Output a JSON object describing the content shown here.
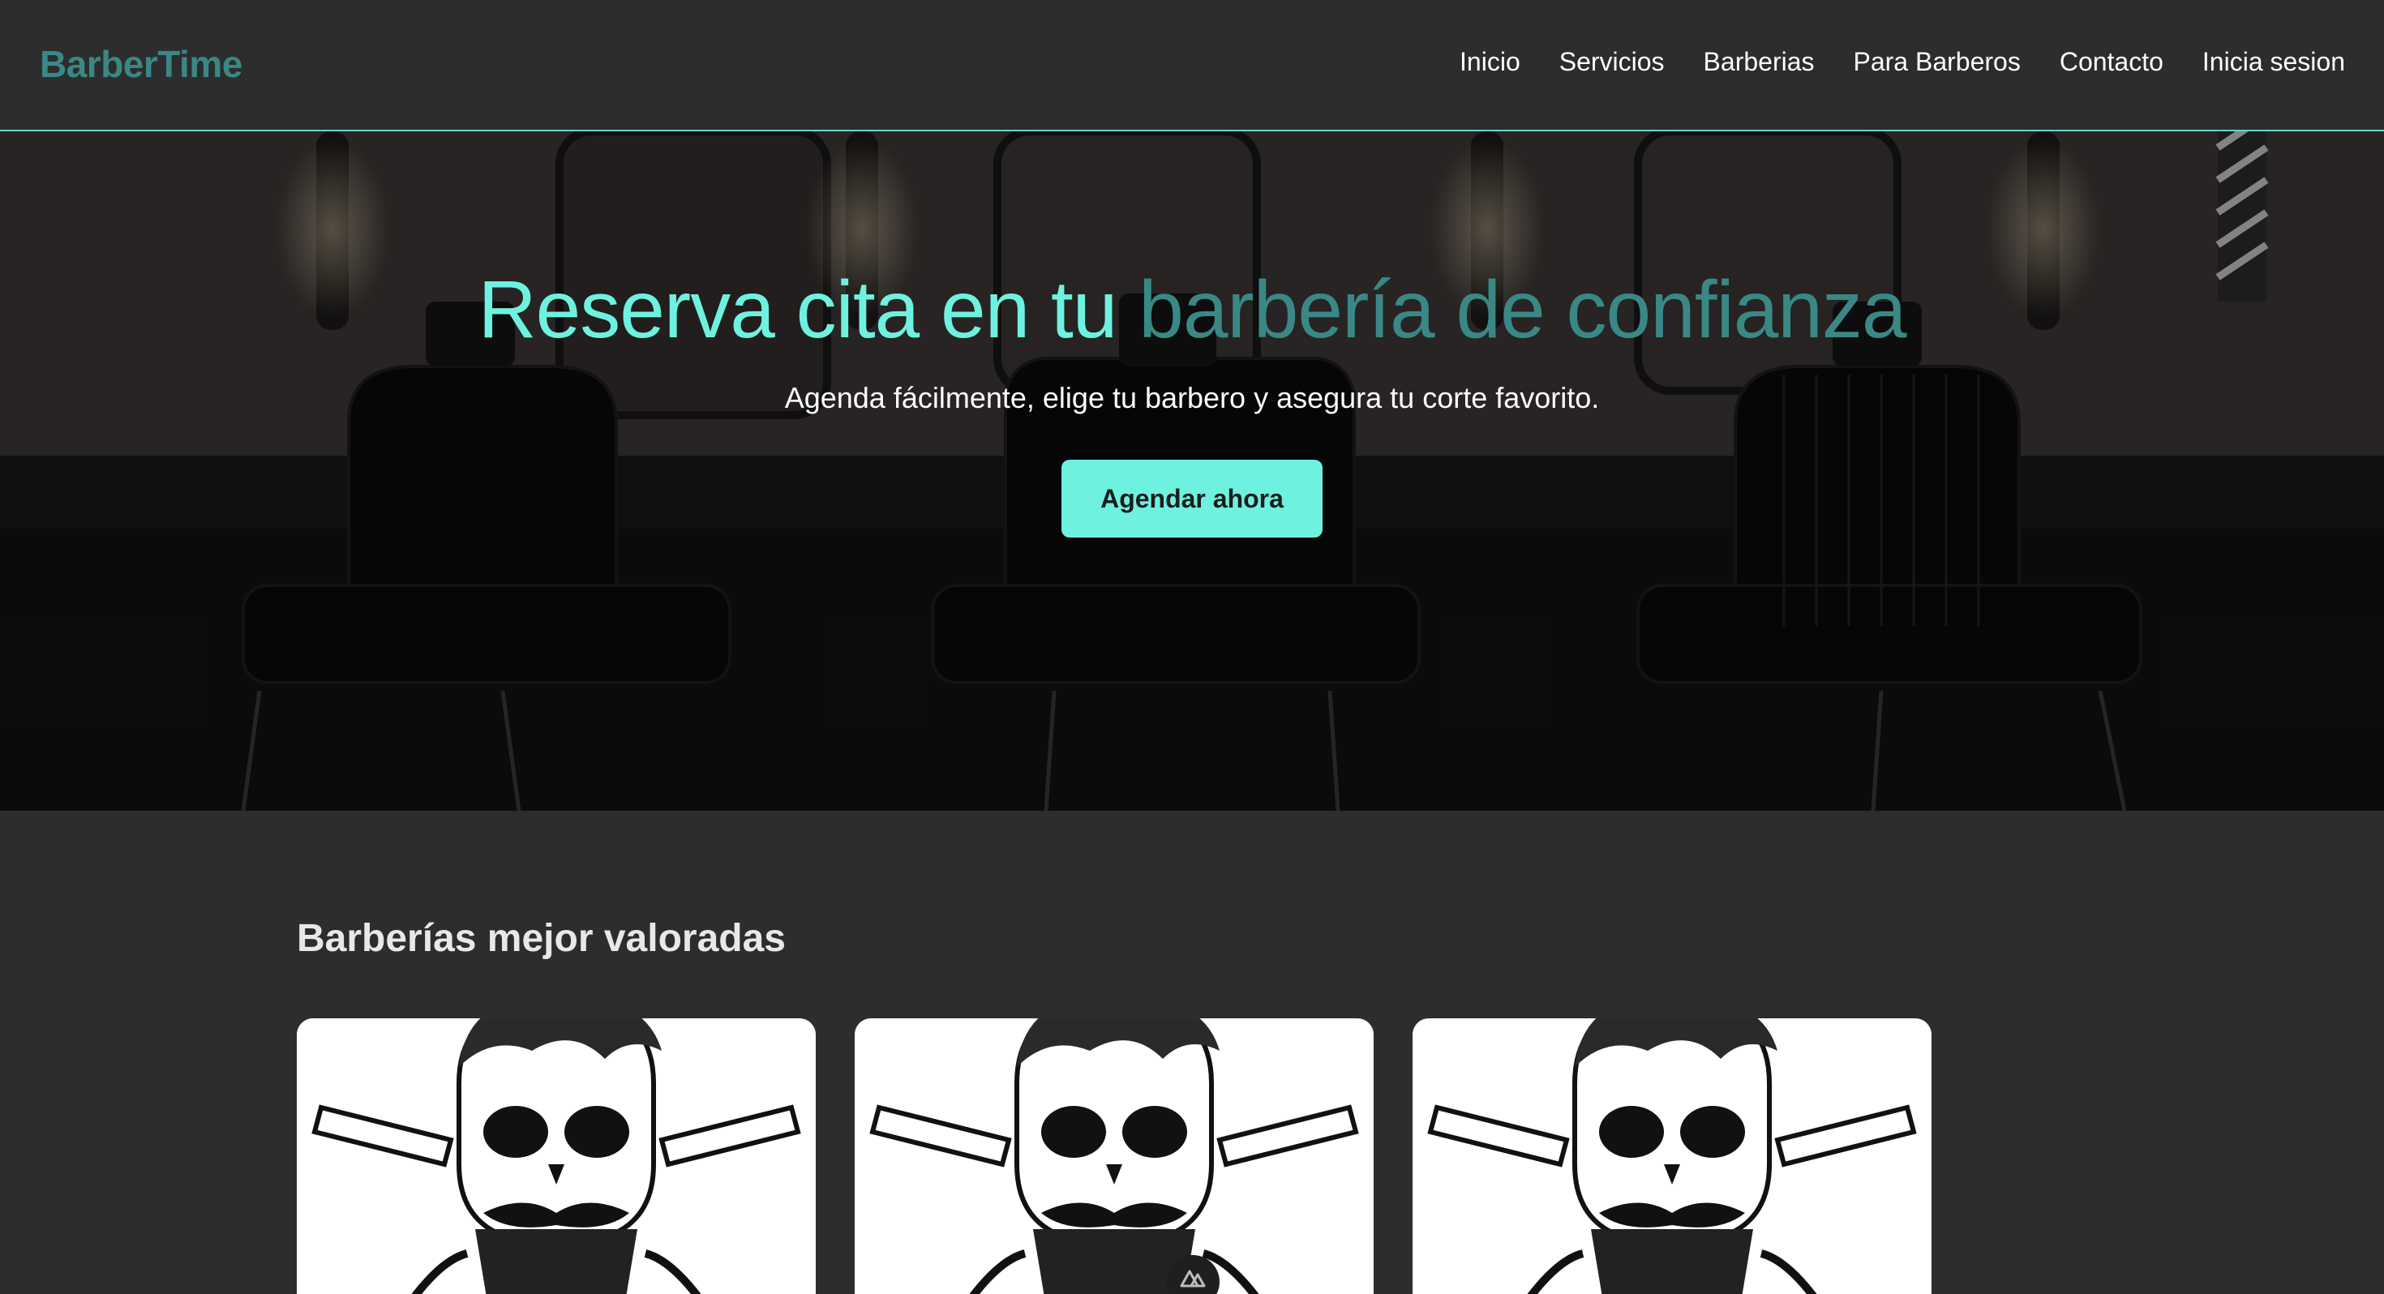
{
  "header": {
    "logo": "BarberTime",
    "nav": [
      "Inicio",
      "Servicios",
      "Barberias",
      "Para Barberos",
      "Contacto",
      "Inicia sesion"
    ]
  },
  "hero": {
    "title_part1": "Reserva cita en tu ",
    "title_part2": "barbería de confianza",
    "subtitle": "Agenda fácilmente, elige tu barbero y asegura tu corte favorito.",
    "cta": "Agendar ahora"
  },
  "section": {
    "title": "Barberías mejor valoradas",
    "cards": [
      {
        "image": "skull-barber-logo"
      },
      {
        "image": "skull-barber-logo"
      },
      {
        "image": "skull-barber-logo"
      }
    ]
  },
  "colors": {
    "background": "#2d2d2d",
    "accent": "#6ef2df",
    "accent_dark": "#3a8886"
  }
}
